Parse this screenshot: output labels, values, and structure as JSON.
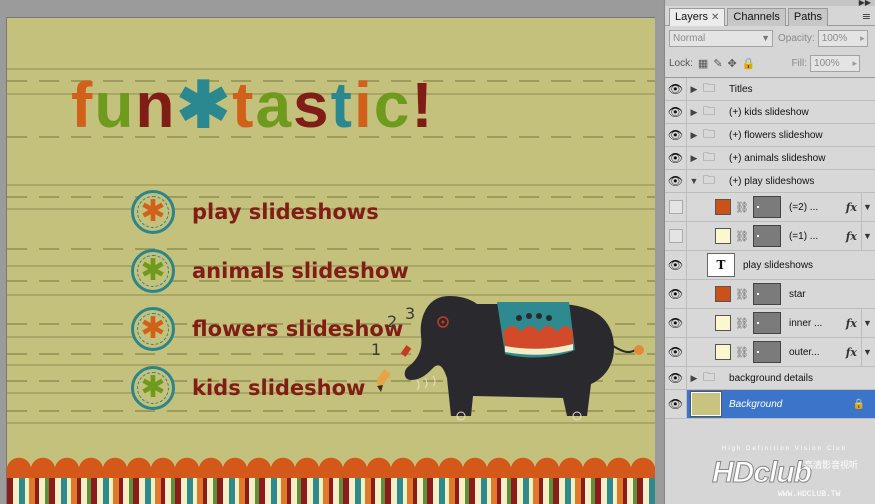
{
  "canvas": {
    "title_letters": [
      {
        "char": "f",
        "color": "#d0601a"
      },
      {
        "char": "u",
        "color": "#6e9a1e"
      },
      {
        "char": "n",
        "color": "#7f1d16"
      },
      {
        "char": "*",
        "color": "#2b8790"
      },
      {
        "char": "t",
        "color": "#d0601a"
      },
      {
        "char": "a",
        "color": "#6e9a1e"
      },
      {
        "char": "s",
        "color": "#7f1d16"
      },
      {
        "char": "t",
        "color": "#2b8790"
      },
      {
        "char": "i",
        "color": "#d0601a"
      },
      {
        "char": "c",
        "color": "#6e9a1e"
      },
      {
        "char": "!",
        "color": "#7f1d16"
      }
    ],
    "menu": [
      {
        "label": "play slideshows",
        "star_color": "#d0601a"
      },
      {
        "label": "animals slideshow",
        "star_color": "#6e9a1e"
      },
      {
        "label": "flowers slideshow",
        "star_color": "#d0601a"
      },
      {
        "label": "kids slideshow",
        "star_color": "#6e9a1e"
      }
    ],
    "scribble_numbers": [
      "1",
      "2",
      "3"
    ]
  },
  "panel": {
    "tabs": [
      {
        "label": "Layers",
        "active": true,
        "closable": true
      },
      {
        "label": "Channels",
        "active": false,
        "closable": false
      },
      {
        "label": "Paths",
        "active": false,
        "closable": false
      }
    ],
    "blend_mode": "Normal",
    "opacity_label": "Opacity:",
    "opacity_value": "100%",
    "lock_label": "Lock:",
    "fill_label": "Fill:",
    "fill_value": "100%",
    "layers": [
      {
        "name": "Titles",
        "kind": "group",
        "visible": true,
        "expanded": false
      },
      {
        "name": "(+) kids slideshow",
        "kind": "group",
        "visible": true,
        "expanded": false
      },
      {
        "name": "(+) flowers slideshow",
        "kind": "group",
        "visible": true,
        "expanded": false
      },
      {
        "name": "(+) animals slideshow",
        "kind": "group",
        "visible": true,
        "expanded": false
      },
      {
        "name": "(+) play slideshows",
        "kind": "group",
        "visible": true,
        "expanded": true
      },
      {
        "name": "(=2) ...",
        "kind": "shape",
        "visible": false,
        "swatch": "#c9521a",
        "fx": true
      },
      {
        "name": "(=1) ...",
        "kind": "shape",
        "visible": false,
        "swatch": "#fbf7cf",
        "fx": true
      },
      {
        "name": "play slideshows",
        "kind": "text",
        "visible": true
      },
      {
        "name": "star",
        "kind": "shape",
        "visible": true,
        "swatch": "#c9521a",
        "fx": false
      },
      {
        "name": "inner ...",
        "kind": "shape",
        "visible": true,
        "swatch": "#fbf7cf",
        "fx": true
      },
      {
        "name": "outer...",
        "kind": "shape",
        "visible": true,
        "swatch": "#fbf7cf",
        "fx": true
      },
      {
        "name": "background details",
        "kind": "group",
        "visible": true,
        "expanded": false
      },
      {
        "name": "Background",
        "kind": "background",
        "visible": true,
        "selected": true
      }
    ]
  },
  "watermark": {
    "tagline": "High Definition Vision Club",
    "logo": "HDclub",
    "chinese": "高清影音视听",
    "url": "WWW.HDCLUB.TW"
  }
}
